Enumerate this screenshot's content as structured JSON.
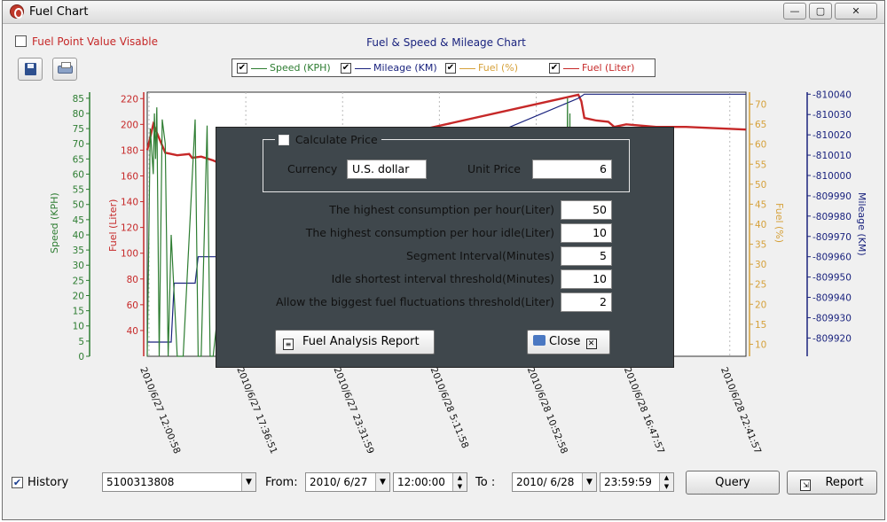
{
  "window": {
    "title": "Fuel Chart",
    "minimize": "—",
    "maximize": "▢",
    "close": "✕"
  },
  "options": {
    "fuel_point_label": "Fuel Point Value Visable",
    "fuel_point_checked": false
  },
  "toolbar": {
    "save_icon": "floppy-disk-icon",
    "print_icon": "printer-icon"
  },
  "legend": [
    {
      "label": "Speed (KPH)",
      "color": "#2e7d32",
      "checked": true
    },
    {
      "label": "Mileage (KM)",
      "color": "#1a237e",
      "checked": true
    },
    {
      "label": "Fuel (%)",
      "color": "#d6a13a",
      "checked": true
    },
    {
      "label": "Fuel (Liter)",
      "color": "#c62828",
      "checked": true
    }
  ],
  "chart_data": {
    "type": "line",
    "title": "Fuel & Speed & Mileage Chart",
    "x_ticks": [
      "2010/6/27 12:00:58",
      "2010/6/27 17:36:51",
      "2010/6/27 23:31:59",
      "2010/6/28 5:11:58",
      "2010/6/28 10:52:58",
      "2010/6/28 16:47:57",
      "2010/6/28 22:41:57"
    ],
    "axes": {
      "speed": {
        "label": "Speed (KPH)",
        "ticks": [
          0,
          5,
          10,
          15,
          20,
          25,
          30,
          35,
          40,
          45,
          50,
          55,
          60,
          65,
          70,
          75,
          80,
          85
        ],
        "range": [
          0,
          87
        ],
        "color": "#2e7d32"
      },
      "fuel_liter": {
        "label": "Fuel (Liter)",
        "ticks": [
          40,
          60,
          80,
          100,
          120,
          140,
          160,
          180,
          200,
          220
        ],
        "range": [
          20,
          225
        ],
        "color": "#c62828"
      },
      "fuel_percent": {
        "label": "Fuel (%)",
        "ticks": [
          10,
          15,
          20,
          25,
          30,
          35,
          40,
          45,
          50,
          55,
          60,
          65,
          70
        ],
        "range": [
          7,
          73
        ],
        "color": "#d6a13a"
      },
      "mileage": {
        "label": "Mileage (KM)",
        "ticks": [
          809920,
          809930,
          809940,
          809950,
          809960,
          809970,
          809980,
          809990,
          810000,
          810010,
          810020,
          810030,
          810040
        ],
        "range": [
          809911,
          810041
        ],
        "color": "#1a237e"
      }
    },
    "x_range": [
      0,
      1
    ],
    "series": [
      {
        "name": "Fuel (Liter)",
        "axis": "fuel_liter",
        "x": [
          0,
          0.01,
          0.03,
          0.05,
          0.07,
          0.075,
          0.09,
          0.11,
          0.13,
          0.15,
          0.16,
          0.17,
          0.72,
          0.725,
          0.73,
          0.75,
          0.77,
          0.78,
          0.8,
          0.85,
          0.9,
          0.95,
          1.0
        ],
        "y": [
          180,
          200,
          178,
          176,
          177,
          174,
          175,
          172,
          168,
          169,
          167,
          166,
          223,
          218,
          205,
          203,
          202,
          198,
          200,
          198,
          198,
          197,
          196
        ]
      },
      {
        "name": "Mileage (KM)",
        "axis": "mileage",
        "x": [
          0,
          0.04,
          0.045,
          0.08,
          0.085,
          0.14,
          0.142,
          0.17,
          0.72,
          0.73,
          0.75,
          1.0
        ],
        "y": [
          809918,
          809918,
          809947,
          809947,
          809960,
          809960,
          809970,
          809970,
          810038,
          810040,
          810040,
          810040
        ]
      },
      {
        "name": "Speed (KPH)",
        "axis": "speed",
        "x": [
          0,
          0.005,
          0.01,
          0.012,
          0.014,
          0.016,
          0.02,
          0.025,
          0.03,
          0.035,
          0.04,
          0.05,
          0.06,
          0.08,
          0.085,
          0.09,
          0.1,
          0.105,
          0.11,
          0.12,
          0.125,
          0.13,
          0.2,
          0.7,
          0.702,
          0.704,
          0.706,
          0.708,
          0.71
        ],
        "y": [
          0,
          75,
          60,
          80,
          65,
          82,
          0,
          78,
          70,
          0,
          40,
          0,
          0,
          78,
          0,
          0,
          76,
          0,
          0,
          18,
          0,
          0,
          0,
          0,
          85,
          0,
          80,
          0,
          0
        ]
      }
    ]
  },
  "dialog": {
    "calc_price_label": "Calculate Price",
    "calc_price_checked": false,
    "currency_label": "Currency",
    "currency_value": "U.S. dollar",
    "unit_price_label": "Unit Price",
    "unit_price_value": "6",
    "params": [
      {
        "label": "The highest consumption per hour(Liter)",
        "value": "50"
      },
      {
        "label": "The highest consumption per hour idle(Liter)",
        "value": "10"
      },
      {
        "label": "Segment Interval(Minutes)",
        "value": "5"
      },
      {
        "label": "Idle shortest interval threshold(Minutes)",
        "value": "10"
      },
      {
        "label": "Allow the biggest fuel fluctuations threshold(Liter)",
        "value": "2"
      }
    ],
    "report_button": "Fuel Analysis Report",
    "close_button": "Close"
  },
  "bottom": {
    "history_label": "History",
    "history_checked": true,
    "device_id": "5100313808",
    "from_label": "From",
    "from_date": "2010/ 6/27",
    "from_time": "12:00:00",
    "to_label": "To",
    "to_date": "2010/ 6/28",
    "to_time": "23:59:59",
    "query_button": "Query",
    "report_button": "Report"
  }
}
